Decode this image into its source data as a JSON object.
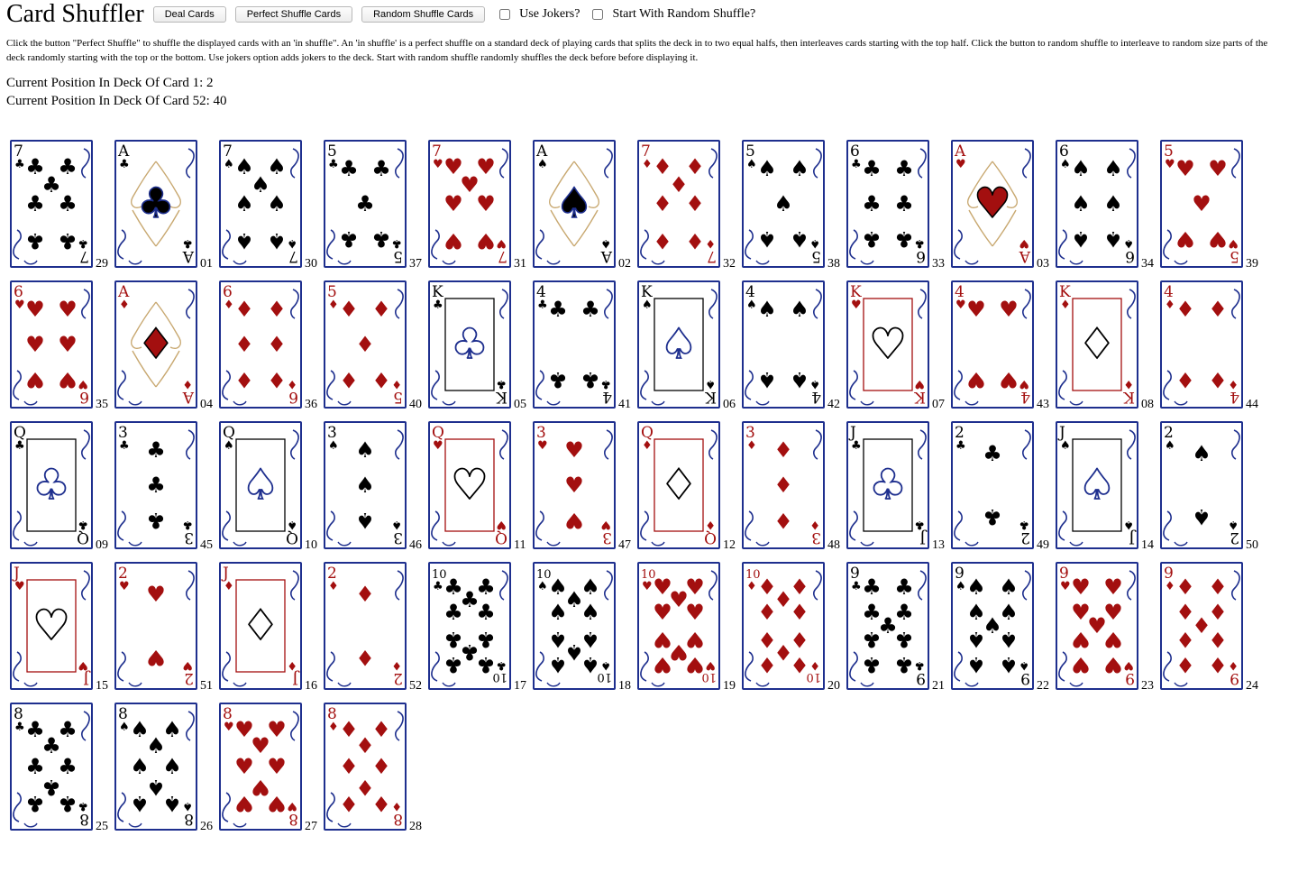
{
  "header": {
    "title": "Card Shuffler",
    "deal_label": "Deal Cards",
    "perfect_label": "Perfect Shuffle Cards",
    "random_label": "Random Shuffle Cards",
    "jokers_label": "Use Jokers?",
    "random_start_label": "Start With Random Shuffle?",
    "jokers_checked": false,
    "random_start_checked": false
  },
  "description": "Click the button \"Perfect Shuffle\" to shuffle the displayed cards with an 'in shuffle\". An 'in shuffle' is a perfect shuffle on a standard deck of playing cards that splits the deck in to two equal halfs, then interleaves cards starting with the top half. Click the button to random shuffle to interleave to random size parts of the deck randomly starting with the top or the bottom. Use jokers option adds jokers to the deck. Start with random shuffle randomly shuffles the deck before before displaying it.",
  "positions": {
    "card1": "Current Position In Deck Of Card 1: 2",
    "card52": "Current Position In Deck Of Card 52: 40"
  },
  "colors": {
    "red": "#a30f0f",
    "black": "#000000",
    "border": "#1e2f8e",
    "gold": "#c8a870"
  },
  "cards": [
    {
      "rank": "7",
      "suit": "clubs",
      "num": "29"
    },
    {
      "rank": "A",
      "suit": "clubs",
      "num": "01"
    },
    {
      "rank": "7",
      "suit": "spades",
      "num": "30"
    },
    {
      "rank": "5",
      "suit": "clubs",
      "num": "37"
    },
    {
      "rank": "7",
      "suit": "hearts",
      "num": "31"
    },
    {
      "rank": "A",
      "suit": "spades",
      "num": "02"
    },
    {
      "rank": "7",
      "suit": "diamonds",
      "num": "32"
    },
    {
      "rank": "5",
      "suit": "spades",
      "num": "38"
    },
    {
      "rank": "6",
      "suit": "clubs",
      "num": "33"
    },
    {
      "rank": "A",
      "suit": "hearts",
      "num": "03"
    },
    {
      "rank": "6",
      "suit": "spades",
      "num": "34"
    },
    {
      "rank": "5",
      "suit": "hearts",
      "num": "39"
    },
    {
      "rank": "6",
      "suit": "hearts",
      "num": "35"
    },
    {
      "rank": "A",
      "suit": "diamonds",
      "num": "04"
    },
    {
      "rank": "6",
      "suit": "diamonds",
      "num": "36"
    },
    {
      "rank": "5",
      "suit": "diamonds",
      "num": "40"
    },
    {
      "rank": "K",
      "suit": "clubs",
      "num": "05"
    },
    {
      "rank": "4",
      "suit": "clubs",
      "num": "41"
    },
    {
      "rank": "K",
      "suit": "spades",
      "num": "06"
    },
    {
      "rank": "4",
      "suit": "spades",
      "num": "42"
    },
    {
      "rank": "K",
      "suit": "hearts",
      "num": "07"
    },
    {
      "rank": "4",
      "suit": "hearts",
      "num": "43"
    },
    {
      "rank": "K",
      "suit": "diamonds",
      "num": "08"
    },
    {
      "rank": "4",
      "suit": "diamonds",
      "num": "44"
    },
    {
      "rank": "Q",
      "suit": "clubs",
      "num": "09"
    },
    {
      "rank": "3",
      "suit": "clubs",
      "num": "45"
    },
    {
      "rank": "Q",
      "suit": "spades",
      "num": "10"
    },
    {
      "rank": "3",
      "suit": "spades",
      "num": "46"
    },
    {
      "rank": "Q",
      "suit": "hearts",
      "num": "11"
    },
    {
      "rank": "3",
      "suit": "hearts",
      "num": "47"
    },
    {
      "rank": "Q",
      "suit": "diamonds",
      "num": "12"
    },
    {
      "rank": "3",
      "suit": "diamonds",
      "num": "48"
    },
    {
      "rank": "J",
      "suit": "clubs",
      "num": "13"
    },
    {
      "rank": "2",
      "suit": "clubs",
      "num": "49"
    },
    {
      "rank": "J",
      "suit": "spades",
      "num": "14"
    },
    {
      "rank": "2",
      "suit": "spades",
      "num": "50"
    },
    {
      "rank": "J",
      "suit": "hearts",
      "num": "15"
    },
    {
      "rank": "2",
      "suit": "hearts",
      "num": "51"
    },
    {
      "rank": "J",
      "suit": "diamonds",
      "num": "16"
    },
    {
      "rank": "2",
      "suit": "diamonds",
      "num": "52"
    },
    {
      "rank": "10",
      "suit": "clubs",
      "num": "17"
    },
    {
      "rank": "10",
      "suit": "spades",
      "num": "18"
    },
    {
      "rank": "10",
      "suit": "hearts",
      "num": "19"
    },
    {
      "rank": "10",
      "suit": "diamonds",
      "num": "20"
    },
    {
      "rank": "9",
      "suit": "clubs",
      "num": "21"
    },
    {
      "rank": "9",
      "suit": "spades",
      "num": "22"
    },
    {
      "rank": "9",
      "suit": "hearts",
      "num": "23"
    },
    {
      "rank": "9",
      "suit": "diamonds",
      "num": "24"
    },
    {
      "rank": "8",
      "suit": "clubs",
      "num": "25"
    },
    {
      "rank": "8",
      "suit": "spades",
      "num": "26"
    },
    {
      "rank": "8",
      "suit": "hearts",
      "num": "27"
    },
    {
      "rank": "8",
      "suit": "diamonds",
      "num": "28"
    }
  ]
}
